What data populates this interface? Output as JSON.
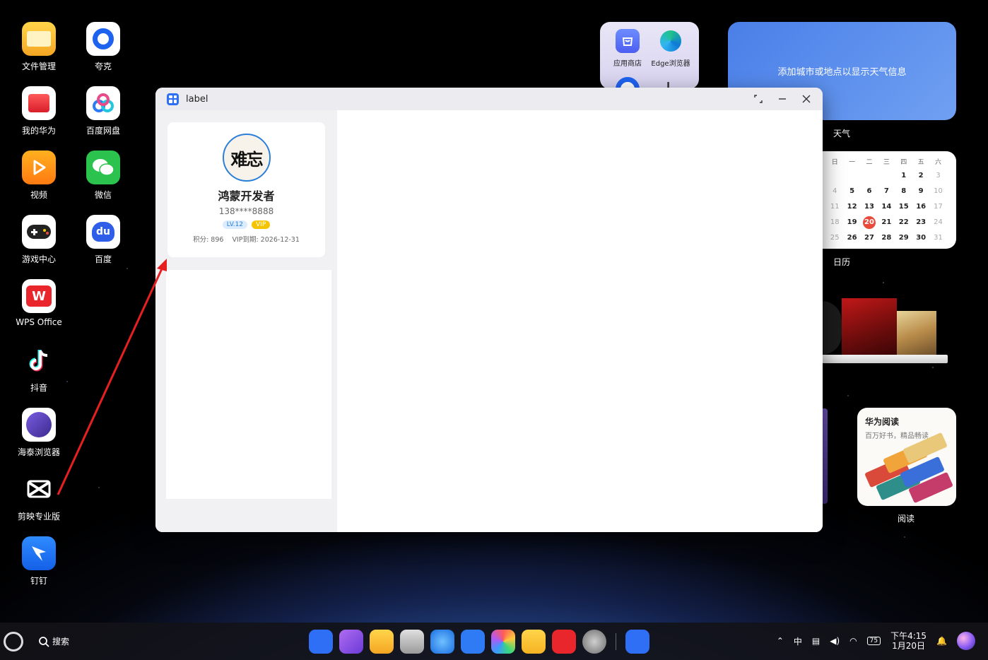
{
  "desktop": {
    "icons": [
      {
        "label": "文件管理",
        "icon": "folder-icon"
      },
      {
        "label": "夸克",
        "icon": "quark-icon"
      },
      {
        "label": "我的华为",
        "icon": "myhuawei-icon"
      },
      {
        "label": "百度网盘",
        "icon": "baidu-netdisk-icon"
      },
      {
        "label": "视频",
        "icon": "video-icon"
      },
      {
        "label": "微信",
        "icon": "wechat-icon"
      },
      {
        "label": "游戏中心",
        "icon": "gamepad-icon"
      },
      {
        "label": "百度",
        "icon": "baidu-icon"
      },
      {
        "label": "WPS Office",
        "icon": "wps-icon"
      },
      {
        "label": "抖音",
        "icon": "douyin-icon"
      },
      {
        "label": "海泰浏览器",
        "icon": "haitai-browser-icon"
      },
      {
        "label": "剪映专业版",
        "icon": "capcut-icon"
      },
      {
        "label": "钉钉",
        "icon": "dingtalk-icon"
      }
    ]
  },
  "folder_widget": {
    "apps": [
      {
        "label": "应用商店",
        "icon": "app-store-icon"
      },
      {
        "label": "Edge浏览器",
        "icon": "edge-icon"
      }
    ]
  },
  "weather_widget": {
    "message": "添加城市或地点以显示天气信息",
    "caption": "天气"
  },
  "calendar_widget": {
    "caption": "日历",
    "weekdays": [
      "日",
      "一",
      "二",
      "三",
      "四",
      "五",
      "六"
    ],
    "weeks": [
      [
        "",
        "",
        "",
        "",
        "1",
        "2",
        "3"
      ],
      [
        "4",
        "5",
        "6",
        "7",
        "8",
        "9",
        "10"
      ],
      [
        "11",
        "12",
        "13",
        "14",
        "15",
        "16",
        "17"
      ],
      [
        "18",
        "19",
        "20",
        "21",
        "22",
        "23",
        "24"
      ],
      [
        "25",
        "26",
        "27",
        "28",
        "29",
        "30",
        "31"
      ]
    ],
    "today": "20"
  },
  "reading_widget": {
    "title": "华为阅读",
    "subtitle": "百万好书，精品畅读",
    "caption": "阅读"
  },
  "window": {
    "title": "label",
    "profile": {
      "avatar_text": "难忘",
      "name": "鸿蒙开发者",
      "phone": "138****8888",
      "level_badge": "LV.12",
      "vip_badge": "VIP",
      "points": "积分: 896",
      "vip_expiry": "VIP到期: 2026-12-31"
    }
  },
  "taskbar": {
    "search_label": "搜索",
    "tray": {
      "ime": "中",
      "battery": "75",
      "time": "下午4:15",
      "date": "1月20日"
    },
    "dock_apps": [
      "launcher-icon",
      "multitask-icon",
      "files-icon",
      "trash-icon",
      "browser-icon",
      "mail-icon",
      "gallery-icon",
      "notes-icon",
      "app-gallery-icon",
      "settings-icon",
      "label-app-icon"
    ]
  },
  "colors": {
    "accent": "#2f6ff5",
    "vip": "#f5c400",
    "calendar_today": "#e84a3c",
    "annotation_arrow": "#e62020"
  }
}
